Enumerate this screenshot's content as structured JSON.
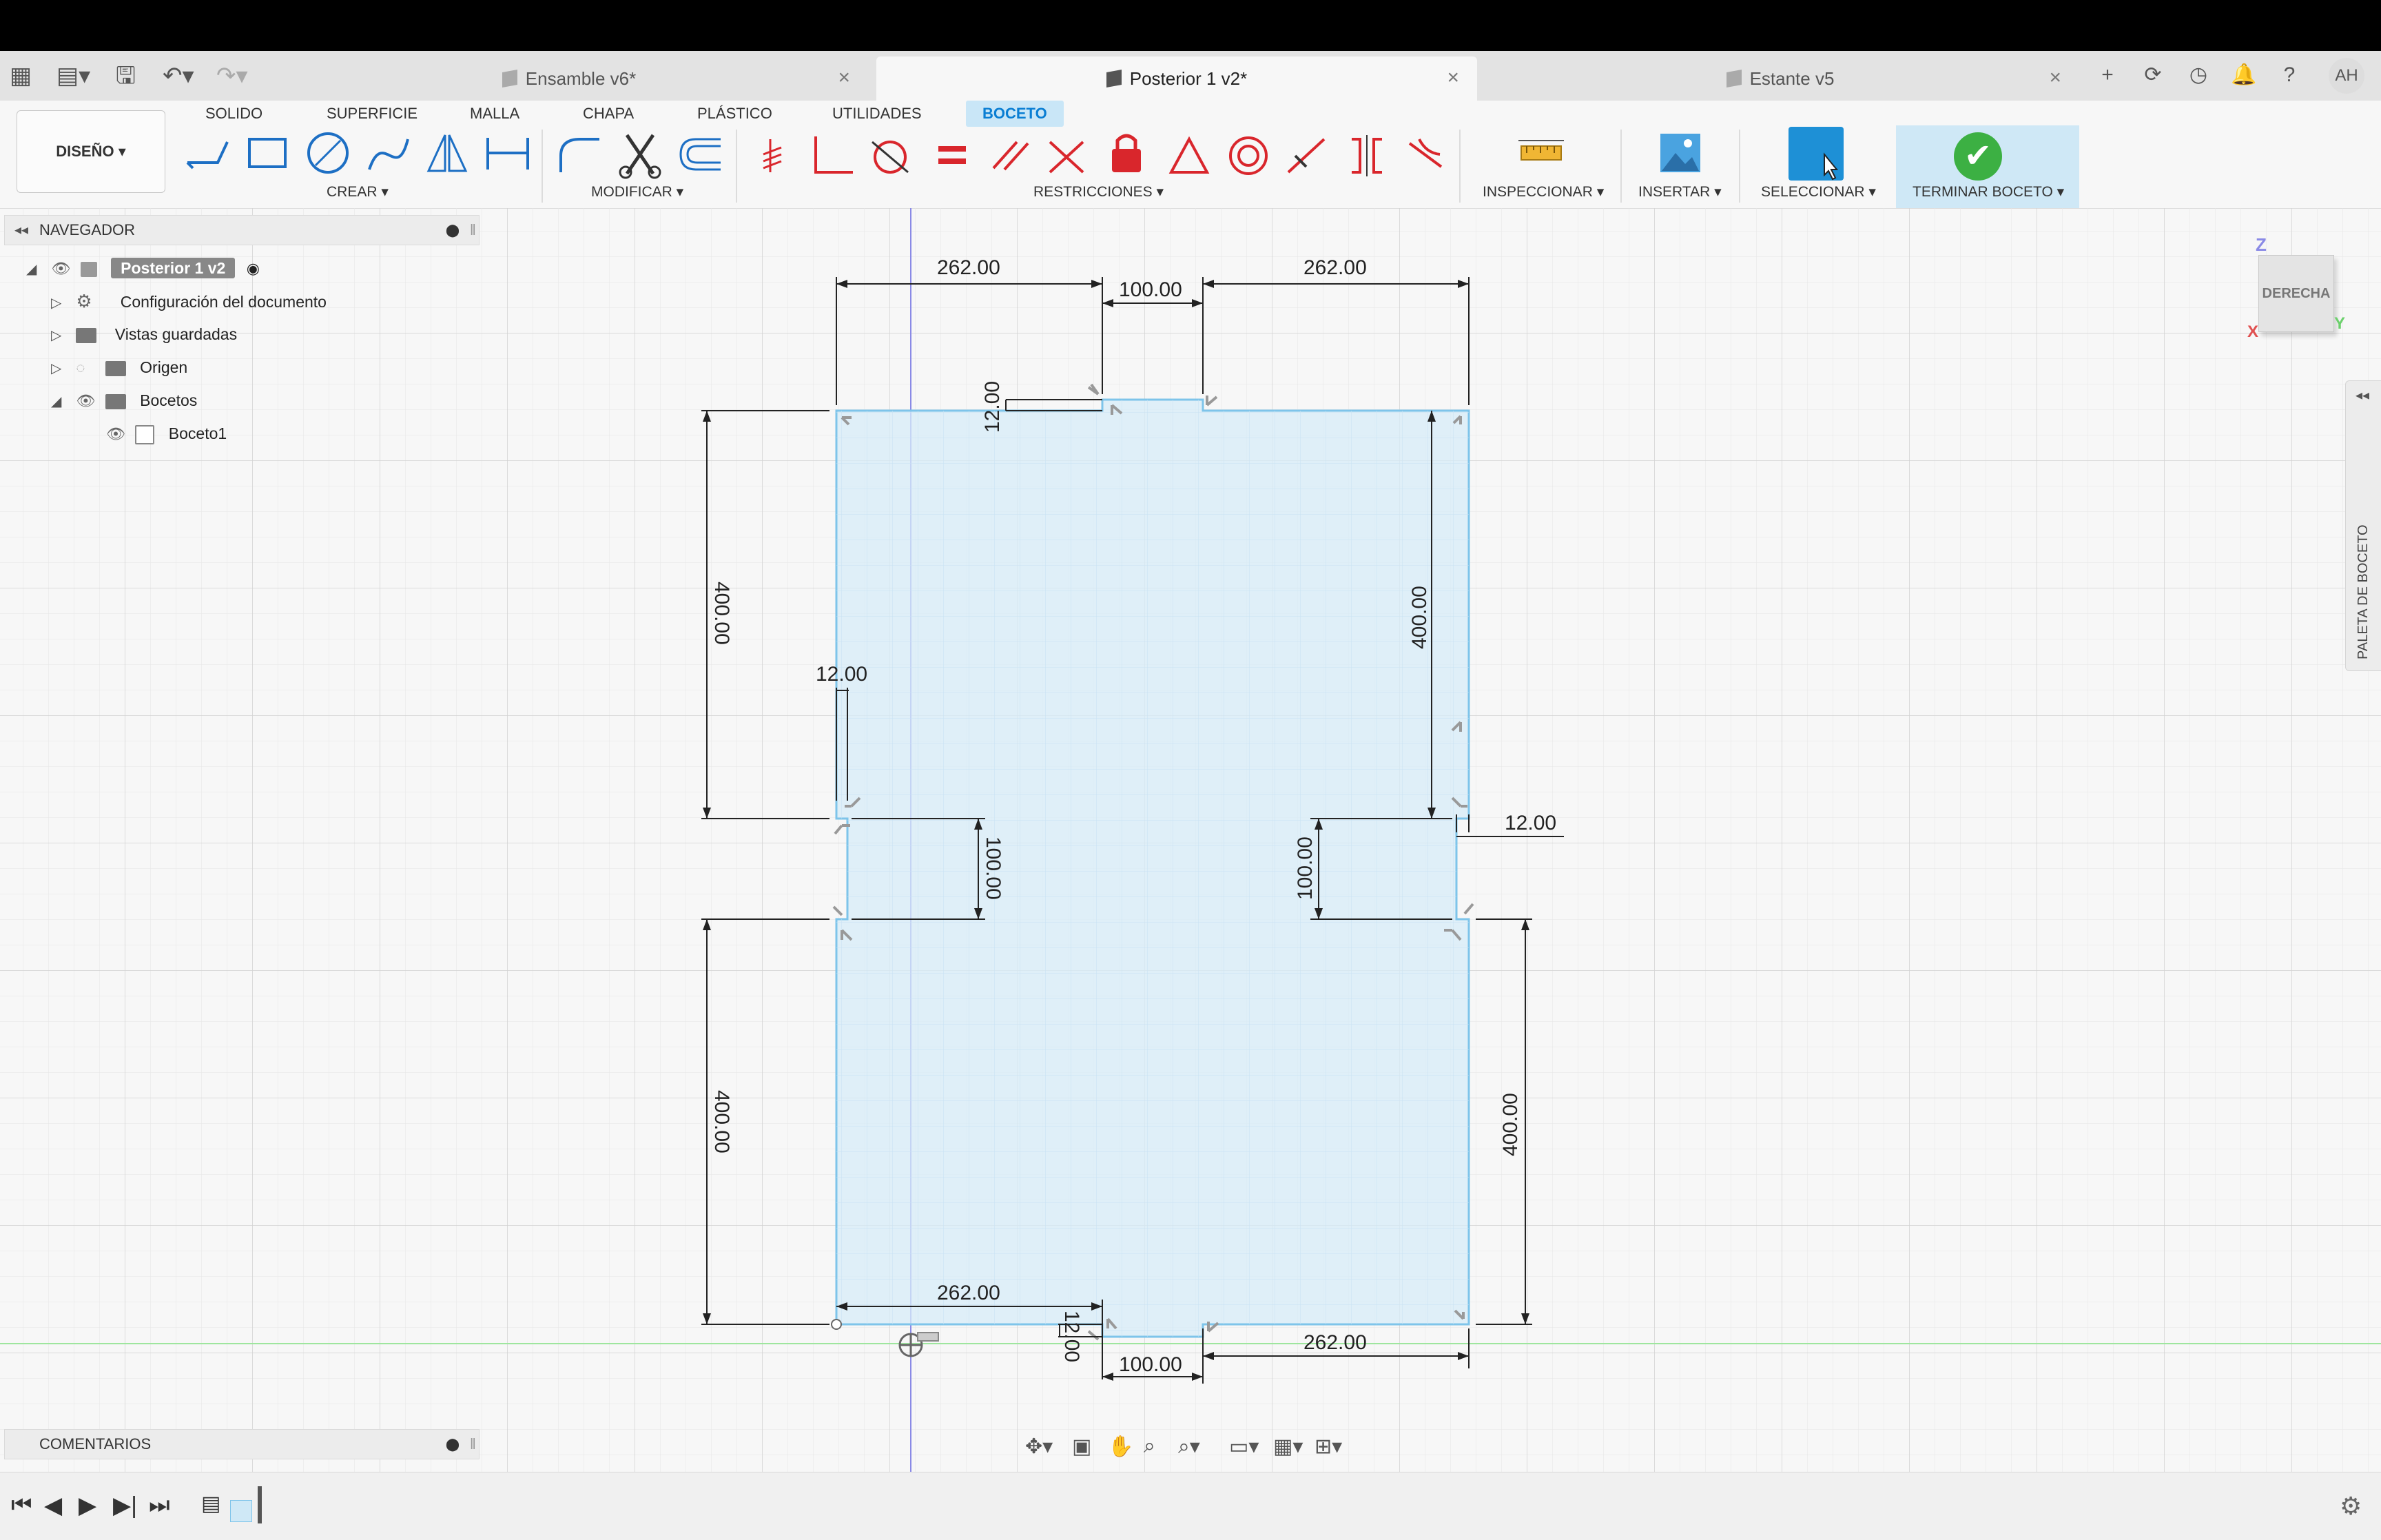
{
  "tabs": [
    {
      "label": "Ensamble v6*",
      "active": false
    },
    {
      "label": "Posterior 1 v2*",
      "active": true
    },
    {
      "label": "Estante v5",
      "active": false
    }
  ],
  "user": {
    "initials": "AH"
  },
  "workspace": {
    "label": "DISEÑO ▾"
  },
  "menu_tabs": [
    "SOLIDO",
    "SUPERFICIE",
    "MALLA",
    "CHAPA",
    "PLÁSTICO",
    "UTILIDADES",
    "BOCETO"
  ],
  "menu_active": "BOCETO",
  "groups": {
    "create": "CREAR ▾",
    "modify": "MODIFICAR ▾",
    "constraints": "RESTRICCIONES ▾",
    "inspect": "INSPECCIONAR ▾",
    "insert": "INSERTAR ▾",
    "select": "SELECCIONAR ▾",
    "finish": "TERMINAR BOCETO ▾"
  },
  "navigator": {
    "title": "NAVEGADOR",
    "root": "Posterior 1 v2",
    "items": [
      "Configuración del documento",
      "Vistas guardadas",
      "Origen",
      "Bocetos",
      "Boceto1"
    ]
  },
  "comments": {
    "title": "COMENTARIOS"
  },
  "viewcube": {
    "face": "DERECHA",
    "axis_z": "Z",
    "axis_x": "X",
    "axis_y": "Y"
  },
  "palette": {
    "label": "PALETA DE BOCETO"
  },
  "dimensions": {
    "top_left": "262.00",
    "top_center": "100.00",
    "top_right": "262.00",
    "notch_top": "12.00",
    "left_upper": "400.00",
    "left_notch_w": "12.00",
    "left_notch_h": "100.00",
    "left_lower": "400.00",
    "right_upper": "400.00",
    "right_notch_w": "12.00",
    "right_notch_h": "100.00",
    "right_lower": "400.00",
    "bottom_left": "262.00",
    "notch_bottom": "12.00",
    "bottom_center": "100.00",
    "bottom_right": "262.00"
  },
  "colors": {
    "accent": "#0a7ed3",
    "sketch_fill": "#d7ecf8",
    "sketch_line": "#7ec4ea",
    "finish": "#3cb043",
    "select": "#1e90d6",
    "constraint": "#d9262c"
  }
}
